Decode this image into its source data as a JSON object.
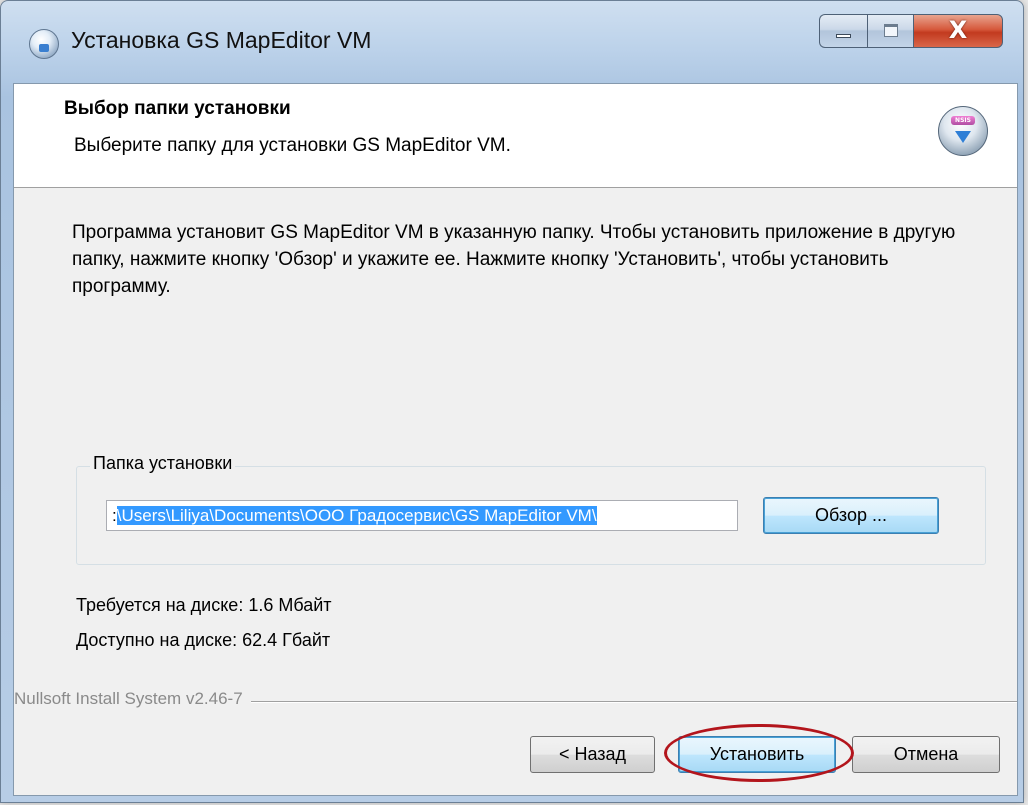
{
  "window": {
    "title": "Установка GS MapEditor VM",
    "app_icon": "installer-globe-icon",
    "caption_buttons": [
      "minimize-icon",
      "maximize-icon",
      "close-icon"
    ]
  },
  "header": {
    "title": "Выбор папки установки",
    "subtitle": "Выберите папку для установки GS MapEditor VM.",
    "icon": "nsis-installer-icon",
    "icon_badge": "NSIS"
  },
  "description": "Программа установит GS MapEditor VM в указанную папку. Чтобы установить приложение в другую папку, нажмите кнопку 'Обзор' и укажите ее. Нажмите кнопку 'Установить', чтобы установить программу.",
  "folder_group": {
    "label": "Папка установки",
    "path_prefix": ":",
    "path_selected": "\\Users\\Liliya\\Documents\\ООО Градосервис\\GS MapEditor VM\\",
    "browse_button": "Обзор ..."
  },
  "space": {
    "required": "Требуется на диске: 1.6 Мбайт",
    "available": "Доступно на диске: 62.4 Гбайт"
  },
  "branding": "Nullsoft Install System v2.46-7",
  "buttons": {
    "back": "< Назад",
    "install": "Установить",
    "cancel": "Отмена"
  },
  "colors": {
    "selection": "#3399ff",
    "highlight_annotation": "#b3151c",
    "close_button": "#c23a1f"
  }
}
